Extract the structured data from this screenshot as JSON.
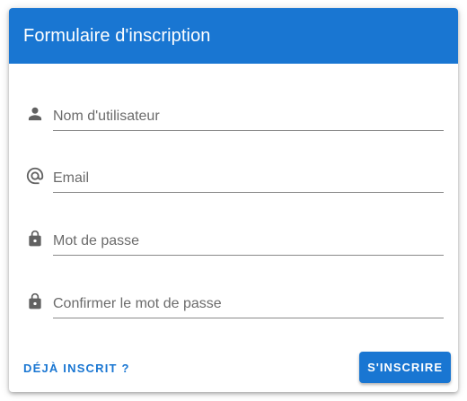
{
  "form": {
    "title": "Formulaire d'inscription",
    "fields": [
      {
        "name": "username",
        "icon": "person-icon",
        "placeholder": "Nom d'utilisateur",
        "value": ""
      },
      {
        "name": "email",
        "icon": "at-icon",
        "placeholder": "Email",
        "value": ""
      },
      {
        "name": "password",
        "icon": "lock-icon",
        "placeholder": "Mot de passe",
        "value": ""
      },
      {
        "name": "confirm-password",
        "icon": "lock-icon",
        "placeholder": "Confirmer le mot de passe",
        "value": ""
      }
    ],
    "already_registered_label": "DÉJÀ INSCRIT ?",
    "submit_label": "S'INSCRIRE"
  },
  "colors": {
    "primary": "#1976d2",
    "icon": "#616161",
    "underline": "#8a8a8a"
  }
}
